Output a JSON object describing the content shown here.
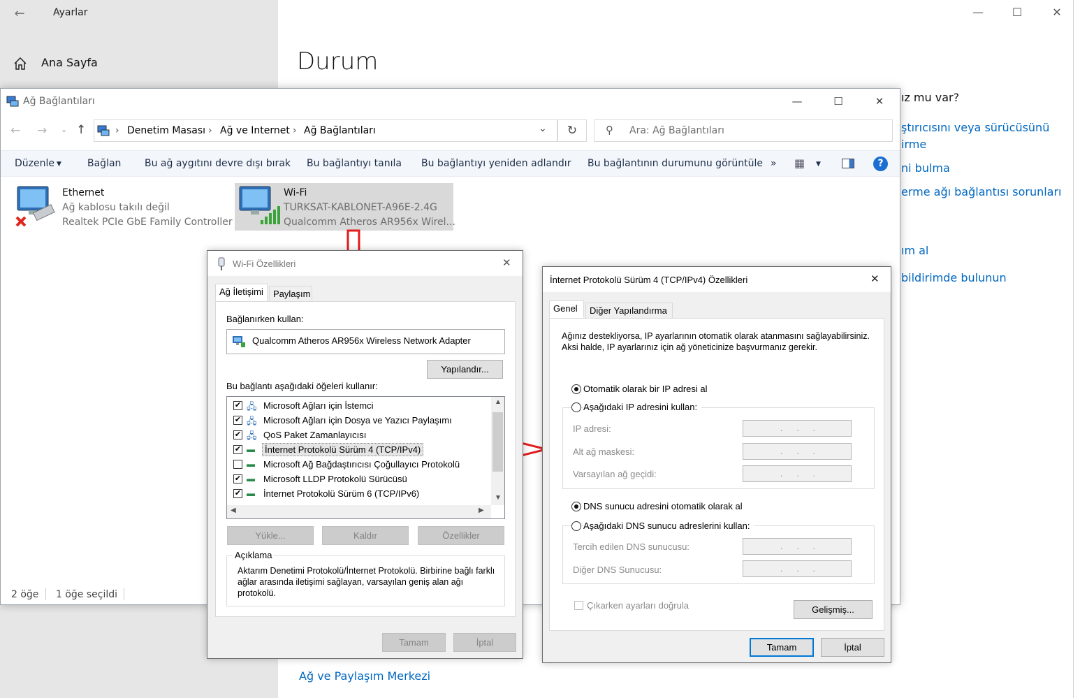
{
  "settings": {
    "title": "Ayarlar",
    "home_label": "Ana Sayfa",
    "page_title": "Durum",
    "right_partial": {
      "question": "ız mu var?",
      "link1a": "ştırıcısını veya sürücüsünü",
      "link1b": "irme",
      "link2": "ni bulma",
      "link3": "erme ağı bağlantısı sorunları",
      "link4": "ım al",
      "link5": "bildirimde bulunun"
    },
    "bottom_link": "Ağ ve Paylaşım Merkezi"
  },
  "netconn": {
    "title": "Ağ Bağlantıları",
    "breadcrumb": [
      "Denetim Masası",
      "Ağ ve Internet",
      "Ağ Bağlantıları"
    ],
    "search_placeholder": "Ara: Ağ Bağlantıları",
    "commands": {
      "organize": "Düzenle",
      "connect": "Bağlan",
      "disable": "Bu ağ aygıtını devre dışı bırak",
      "diagnose": "Bu bağlantıyı tanıla",
      "rename": "Bu bağlantıyı yeniden adlandır",
      "status": "Bu bağlantının durumunu görüntüle",
      "more": "»"
    },
    "items": [
      {
        "name": "Ethernet",
        "line2": "Ağ kablosu takılı değil",
        "line3": "Realtek PCIe GbE Family Controller"
      },
      {
        "name": "Wi-Fi",
        "line2": "TURKSAT-KABLONET-A96E-2.4G",
        "line3": "Qualcomm Atheros AR956x Wirel..."
      }
    ],
    "status": {
      "count": "2 öğe",
      "selected": "1 öğe seçildi"
    }
  },
  "wifi_props": {
    "title": "Wi-Fi Özellikleri",
    "tabs": [
      "Ağ İletişimi",
      "Paylaşım"
    ],
    "connect_using_label": "Bağlanırken kullan:",
    "adapter": "Qualcomm Atheros AR956x Wireless Network Adapter",
    "configure": "Yapılandır...",
    "items_label": "Bu bağlantı aşağıdaki öğeleri kullanır:",
    "items": [
      {
        "label": "Microsoft Ağları için İstemci",
        "checked": "✔"
      },
      {
        "label": "Microsoft Ağları için Dosya ve Yazıcı Paylaşımı",
        "checked": "✔"
      },
      {
        "label": "QoS Paket Zamanlayıcısı",
        "checked": "✔"
      },
      {
        "label": "İnternet Protokolü Sürüm 4 (TCP/IPv4)",
        "checked": "✔"
      },
      {
        "label": "Microsoft Ağ Bağdaştırıcısı Çoğullayıcı Protokolü",
        "checked": ""
      },
      {
        "label": "Microsoft LLDP Protokolü Sürücüsü",
        "checked": "✔"
      },
      {
        "label": "İnternet Protokolü Sürüm 6 (TCP/IPv6)",
        "checked": "✔"
      }
    ],
    "install": "Yükle...",
    "uninstall": "Kaldır",
    "properties": "Özellikler",
    "description_label": "Açıklama",
    "description": "Aktarım Denetimi Protokolü/İnternet Protokolü. Birbirine bağlı farklı ağlar arasında iletişimi sağlayan, varsayılan geniş alan ağı protokolü.",
    "ok": "Tamam",
    "cancel": "İptal"
  },
  "ipv4_props": {
    "title": "İnternet Protokolü Sürüm 4 (TCP/IPv4) Özellikleri",
    "tabs": [
      "Genel",
      "Diğer Yapılandırma"
    ],
    "intro": "Ağınız destekliyorsa, IP ayarlarının otomatik olarak atanmasını sağlayabilirsiniz. Aksi halde, IP ayarlarınız için ağ yöneticinize başvurmanız gerekir.",
    "auto_ip": "Otomatik olarak bir IP adresi al",
    "manual_ip": "Aşağıdaki IP adresini kullan:",
    "ip_address": "IP adresi:",
    "subnet": "Alt ağ maskesi:",
    "gateway": "Varsayılan ağ geçidi:",
    "auto_dns": "DNS sunucu adresini otomatik olarak al",
    "manual_dns": "Aşağıdaki DNS sunucu adreslerini kullan:",
    "preferred_dns": "Tercih edilen DNS sunucusu:",
    "alternate_dns": "Diğer DNS Sunucusu:",
    "ip_placeholder": "...",
    "validate": "Çıkarken ayarları doğrula",
    "advanced": "Gelişmiş...",
    "ok": "Tamam",
    "cancel": "İptal"
  },
  "colors": {
    "arrow": "#e31b1b",
    "link": "#0067c0",
    "accent": "#0078d7"
  }
}
